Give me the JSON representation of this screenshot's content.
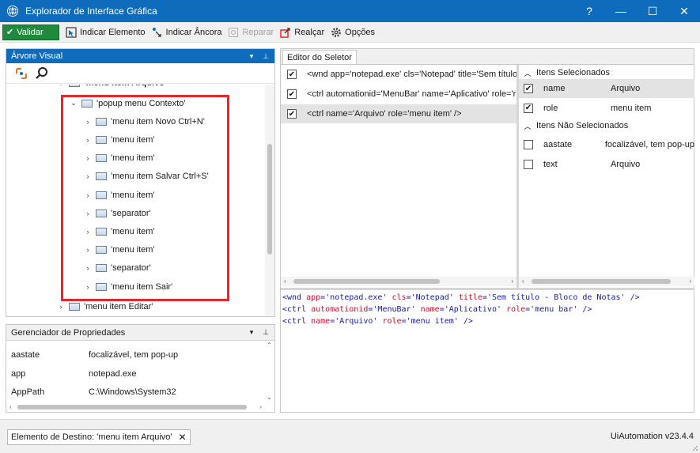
{
  "window": {
    "title": "Explorador de Interface Gráfica",
    "help": "?",
    "minimize": "—",
    "maximize": "☐",
    "close": "✕"
  },
  "toolbar": {
    "validate": "Validar",
    "indicate_element": "Indicar Elemento",
    "indicate_anchor": "Indicar Âncora",
    "repair": "Reparar",
    "highlight": "Realçar",
    "options": "Opções"
  },
  "visual_tree": {
    "header": "Árvore Visual",
    "items": [
      {
        "label": "'menu item  Arquivo'",
        "level": 0,
        "expander": "▼",
        "partial": true
      },
      {
        "label": "'popup menu  Contexto'",
        "level": 1,
        "expander": "⌄"
      },
      {
        "label": "'menu item  Novo Ctrl+N'",
        "level": 2,
        "expander": "›"
      },
      {
        "label": "'menu item'",
        "level": 2,
        "expander": "›"
      },
      {
        "label": "'menu item'",
        "level": 2,
        "expander": "›"
      },
      {
        "label": "'menu item  Salvar Ctrl+S'",
        "level": 2,
        "expander": "›"
      },
      {
        "label": "'menu item'",
        "level": 2,
        "expander": "›"
      },
      {
        "label": "'separator'",
        "level": 2,
        "expander": "›"
      },
      {
        "label": "'menu item'",
        "level": 2,
        "expander": "›"
      },
      {
        "label": "'menu item'",
        "level": 2,
        "expander": "›"
      },
      {
        "label": "'separator'",
        "level": 2,
        "expander": "›"
      },
      {
        "label": "'menu item  Sair'",
        "level": 2,
        "expander": "›"
      },
      {
        "label": "'menu item  Editar'",
        "level": 0,
        "expander": "›"
      }
    ]
  },
  "property_explorer": {
    "header": "Gerenciador de Propriedades",
    "rows": [
      {
        "key": "aastate",
        "value": "focalizável, tem pop-up"
      },
      {
        "key": "app",
        "value": "notepad.exe"
      },
      {
        "key": "AppPath",
        "value": "C:\\Windows\\System32"
      }
    ]
  },
  "selector_editor": {
    "tab": "Editor do Seletor",
    "rows": [
      {
        "checked": true,
        "text": "<wnd app='notepad.exe' cls='Notepad' title='Sem título"
      },
      {
        "checked": true,
        "text": "<ctrl automationid='MenuBar' name='Aplicativo' role='r"
      },
      {
        "checked": true,
        "text": "<ctrl name='Arquivo' role='menu item' />",
        "selected": true
      }
    ],
    "selected_group": "Itens Selecionados",
    "selected_attrs": [
      {
        "checked": true,
        "key": "name",
        "value": "Arquivo",
        "selected": true
      },
      {
        "checked": true,
        "key": "role",
        "value": "menu item"
      }
    ],
    "unselected_group": "Itens Não Selecionados",
    "unselected_attrs": [
      {
        "checked": false,
        "key": "aastate",
        "value": "focalizável, tem pop-up"
      },
      {
        "checked": false,
        "key": "text",
        "value": "Arquivo"
      }
    ],
    "xml_lines": [
      [
        [
          "t",
          "<wnd "
        ],
        [
          "a",
          "app"
        ],
        [
          "t",
          "="
        ],
        [
          "v",
          "'notepad.exe' "
        ],
        [
          "a",
          "cls"
        ],
        [
          "t",
          "="
        ],
        [
          "v",
          "'Notepad' "
        ],
        [
          "a",
          "title"
        ],
        [
          "t",
          "="
        ],
        [
          "v",
          "'Sem título - Bloco de Notas' "
        ],
        [
          "t",
          "/>"
        ]
      ],
      [
        [
          "t",
          "<ctrl "
        ],
        [
          "a",
          "automationid"
        ],
        [
          "t",
          "="
        ],
        [
          "v",
          "'MenuBar' "
        ],
        [
          "a",
          "name"
        ],
        [
          "t",
          "="
        ],
        [
          "v",
          "'Aplicativo' "
        ],
        [
          "a",
          "role"
        ],
        [
          "t",
          "="
        ],
        [
          "v",
          "'menu bar' "
        ],
        [
          "t",
          "/>"
        ]
      ],
      [
        [
          "t",
          "<ctrl "
        ],
        [
          "a",
          "name"
        ],
        [
          "t",
          "="
        ],
        [
          "v",
          "'Arquivo' "
        ],
        [
          "a",
          "role"
        ],
        [
          "t",
          "="
        ],
        [
          "v",
          "'menu item' "
        ],
        [
          "t",
          "/>"
        ]
      ]
    ]
  },
  "status": {
    "target": "Elemento de Destino: 'menu item  Arquivo'",
    "close": "✕",
    "version": "UiAutomation v23.4.4"
  },
  "colors": {
    "accent": "#0f6cbd",
    "validate": "#1f8a3c",
    "highlight_box": "#e8262b"
  }
}
